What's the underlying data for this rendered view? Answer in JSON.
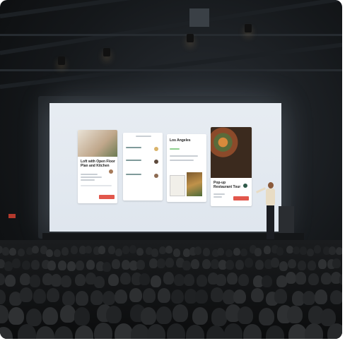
{
  "screen": {
    "cards": [
      {
        "title": "Loft with Open Floor Plan and Kitchen"
      },
      {
        "title": ""
      },
      {
        "title": "Los Angeles"
      },
      {
        "title": "Pop-up Restaurant Tour"
      }
    ]
  },
  "colors": {
    "screen_background": "#e7ecf2",
    "accent_red": "#e2574c",
    "room_dark": "#15181b"
  }
}
